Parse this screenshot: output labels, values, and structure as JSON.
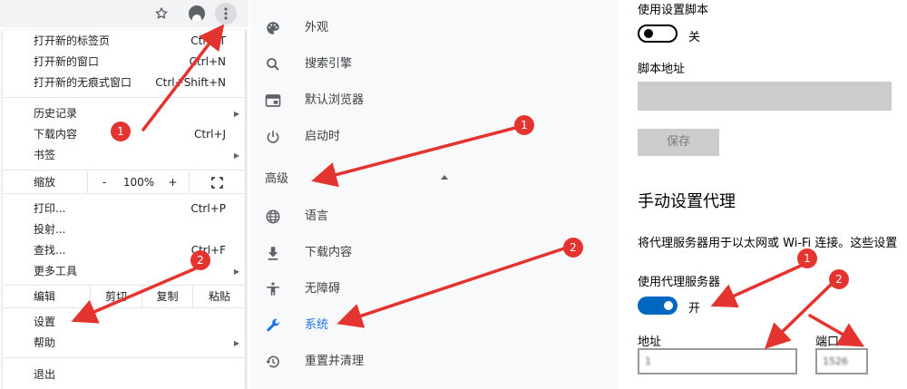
{
  "menu": {
    "items": [
      {
        "label": "打开新的标签页",
        "shortcut": "Ctrl+T"
      },
      {
        "label": "打开新的窗口",
        "shortcut": "Ctrl+N"
      },
      {
        "label": "打开新的无痕式窗口",
        "shortcut": "Ctrl+Shift+N"
      },
      {
        "label": "历史记录",
        "shortcut": ""
      },
      {
        "label": "下载内容",
        "shortcut": "Ctrl+J"
      },
      {
        "label": "书签",
        "shortcut": ""
      },
      {
        "label": "打印...",
        "shortcut": "Ctrl+P"
      },
      {
        "label": "投射...",
        "shortcut": ""
      },
      {
        "label": "查找...",
        "shortcut": "Ctrl+F"
      },
      {
        "label": "更多工具",
        "shortcut": ""
      },
      {
        "label": "设置",
        "shortcut": ""
      },
      {
        "label": "帮助",
        "shortcut": ""
      },
      {
        "label": "退出",
        "shortcut": ""
      }
    ],
    "zoom": {
      "label": "缩放",
      "minus": "-",
      "value": "100%",
      "plus": "+"
    },
    "edit": {
      "label": "编辑",
      "cut": "剪切",
      "copy": "复制",
      "paste": "粘贴"
    }
  },
  "settings_nav": {
    "items": [
      {
        "label": "外观",
        "icon": "palette-icon"
      },
      {
        "label": "搜索引擎",
        "icon": "search-icon"
      },
      {
        "label": "默认浏览器",
        "icon": "browser-icon"
      },
      {
        "label": "启动时",
        "icon": "power-icon"
      },
      {
        "label": "语言",
        "icon": "globe-icon"
      },
      {
        "label": "下载内容",
        "icon": "download-icon"
      },
      {
        "label": "无障碍",
        "icon": "accessibility-icon"
      },
      {
        "label": "系统",
        "icon": "wrench-icon"
      },
      {
        "label": "重置并清理",
        "icon": "restore-icon"
      }
    ],
    "advanced_label": "高级"
  },
  "proxy": {
    "use_script_label": "使用设置脚本",
    "use_script_state": "关",
    "script_address_label": "脚本地址",
    "save_label": "保存",
    "manual_heading": "手动设置代理",
    "description": "将代理服务器用于以太网或 Wi-Fi 连接。这些设置",
    "use_proxy_label": "使用代理服务器",
    "use_proxy_state": "开",
    "address_label": "地址",
    "address_value": "1",
    "port_label": "端口",
    "port_value": "1526"
  },
  "annotations": {
    "badge_1": "1",
    "badge_2": "2"
  },
  "colors": {
    "annotation_red": "#e3342f",
    "toggle_on_blue": "#0067c0",
    "active_nav_blue": "#1a73e8"
  }
}
